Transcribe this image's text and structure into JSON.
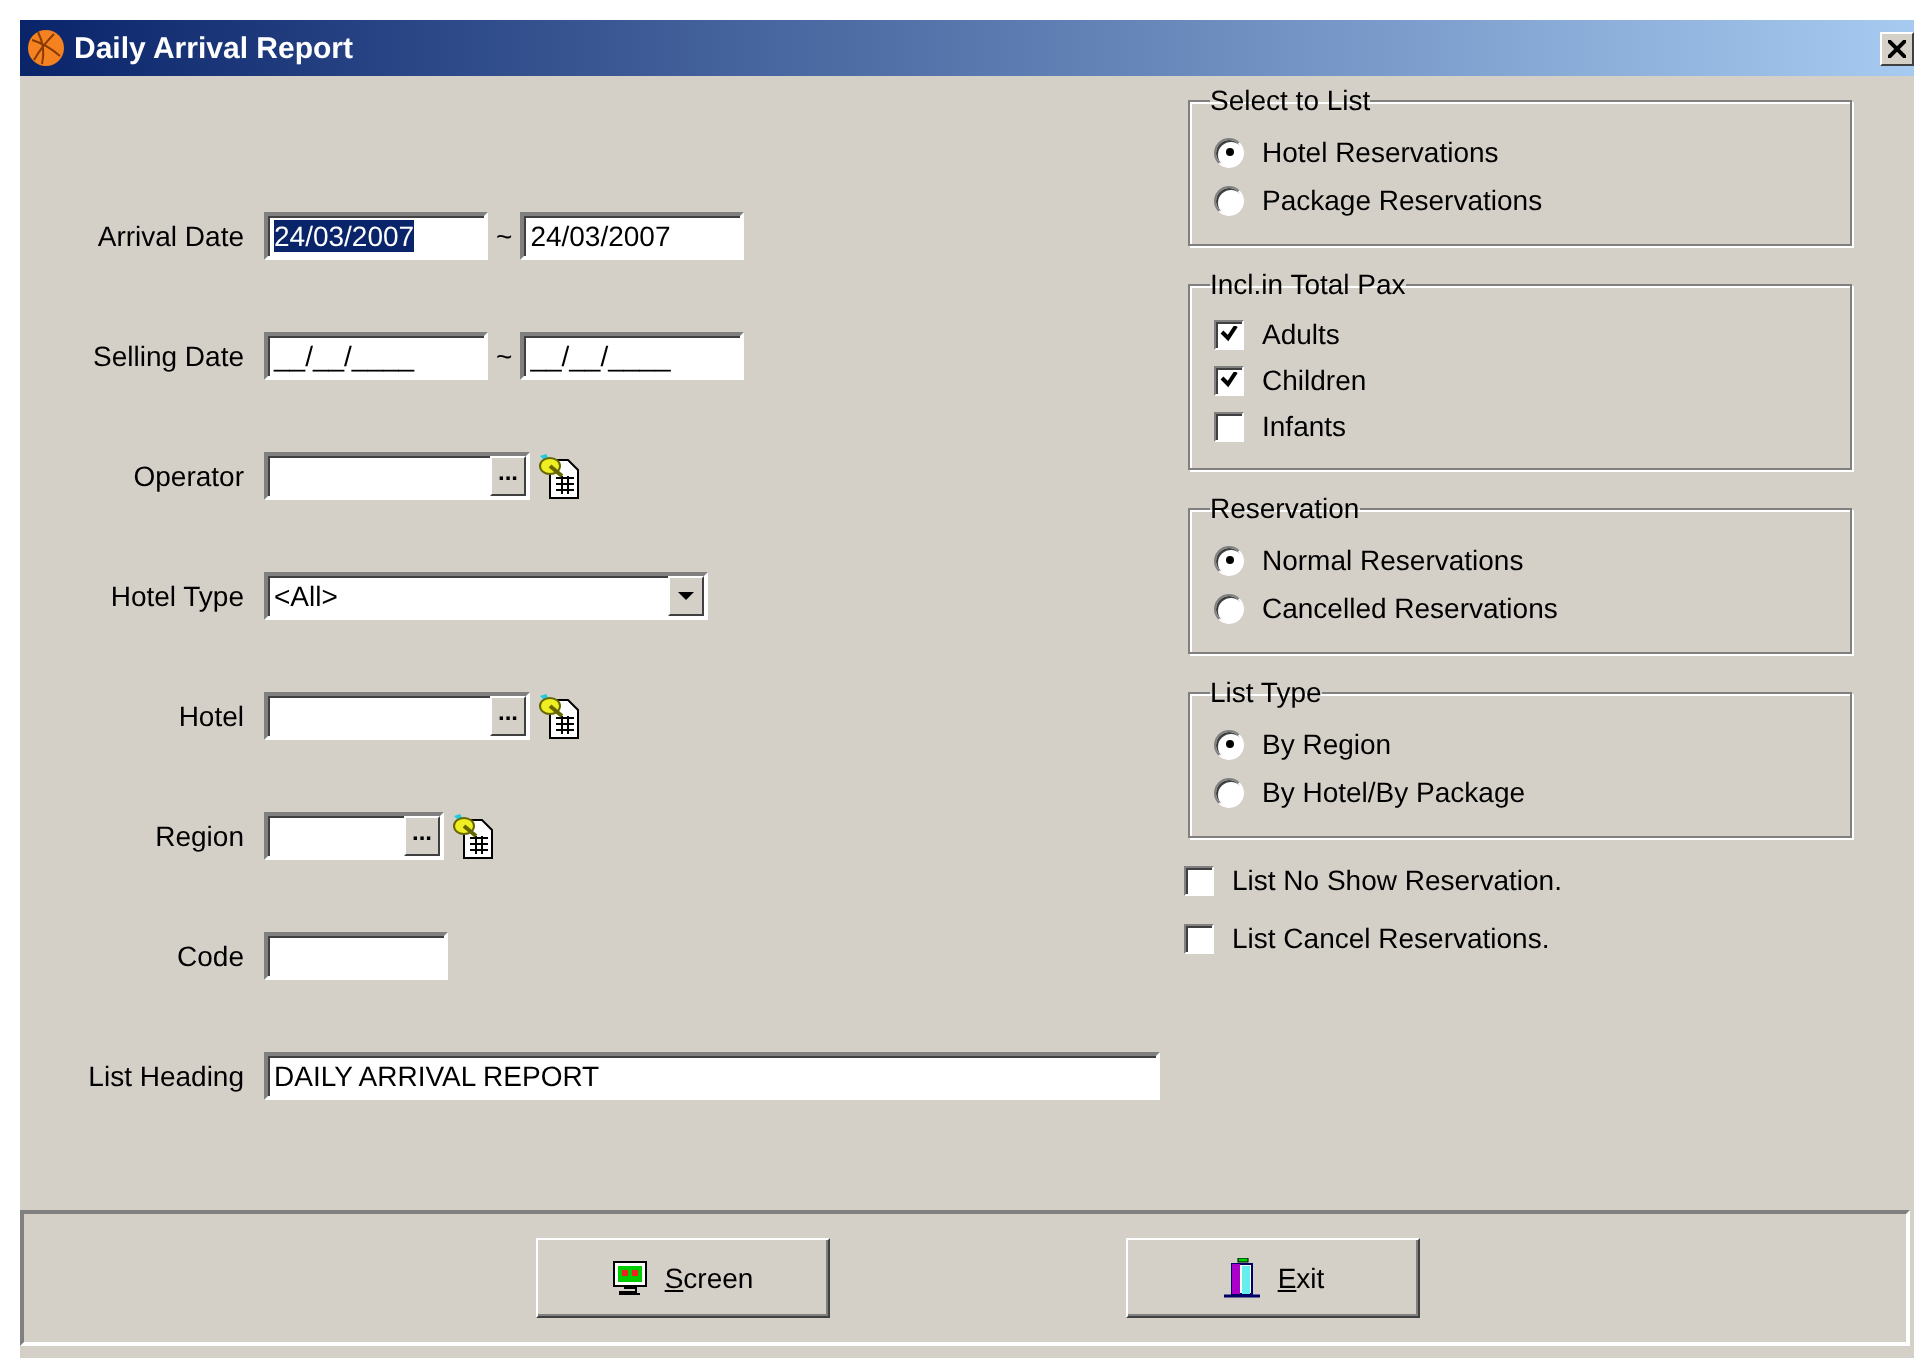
{
  "window": {
    "title": "Daily Arrival Report"
  },
  "fields": [
    {
      "label": "Arrival Date",
      "kind": "date_range",
      "separator": "~",
      "values": [
        {
          "value": "24/03/2007",
          "highlighted": true
        },
        {
          "value": "24/03/2007",
          "highlighted": false
        }
      ]
    },
    {
      "label": "Selling Date",
      "kind": "date_range",
      "separator": "~",
      "values": [
        {
          "value": "__/__/____",
          "highlighted": false
        },
        {
          "value": "__/__/____",
          "highlighted": false
        }
      ]
    },
    {
      "label": "Operator",
      "kind": "lookup",
      "button": "..."
    },
    {
      "label": "Hotel Type",
      "kind": "dropdown",
      "value": "<All>"
    },
    {
      "label": "Hotel",
      "kind": "lookup",
      "button": "..."
    },
    {
      "label": "Region",
      "kind": "short_lookup",
      "button": "..."
    },
    {
      "label": "Code",
      "kind": "short_text"
    },
    {
      "label": "List Heading",
      "kind": "wide_text",
      "value": "DAILY ARRIVAL REPORT"
    }
  ],
  "groups": [
    {
      "title": "Select to List",
      "kind": "radio",
      "options": [
        {
          "label": "Hotel Reservations",
          "selected": true
        },
        {
          "label": "Package Reservations",
          "selected": false
        }
      ]
    },
    {
      "title": "Incl.in Total Pax",
      "kind": "checkbox",
      "options": [
        {
          "label": "Adults",
          "selected": true
        },
        {
          "label": "Children",
          "selected": true
        },
        {
          "label": "Infants",
          "selected": false
        }
      ]
    },
    {
      "title": "Reservation",
      "kind": "radio",
      "options": [
        {
          "label": "Normal Reservations",
          "selected": true
        },
        {
          "label": "Cancelled Reservations",
          "selected": false
        }
      ]
    },
    {
      "title": "List Type",
      "kind": "radio",
      "options": [
        {
          "label": "By Region",
          "selected": true
        },
        {
          "label": "By Hotel/By Package",
          "selected": false
        }
      ]
    }
  ],
  "options": [
    {
      "label": "List No Show Reservation.",
      "checked": false
    },
    {
      "label": "List Cancel Reservations.",
      "checked": false
    }
  ],
  "buttons": [
    {
      "kind": "screen",
      "access_key": "S",
      "label_rest": "creen"
    },
    {
      "kind": "exit",
      "access_key": "E",
      "label_rest": "xit"
    }
  ]
}
